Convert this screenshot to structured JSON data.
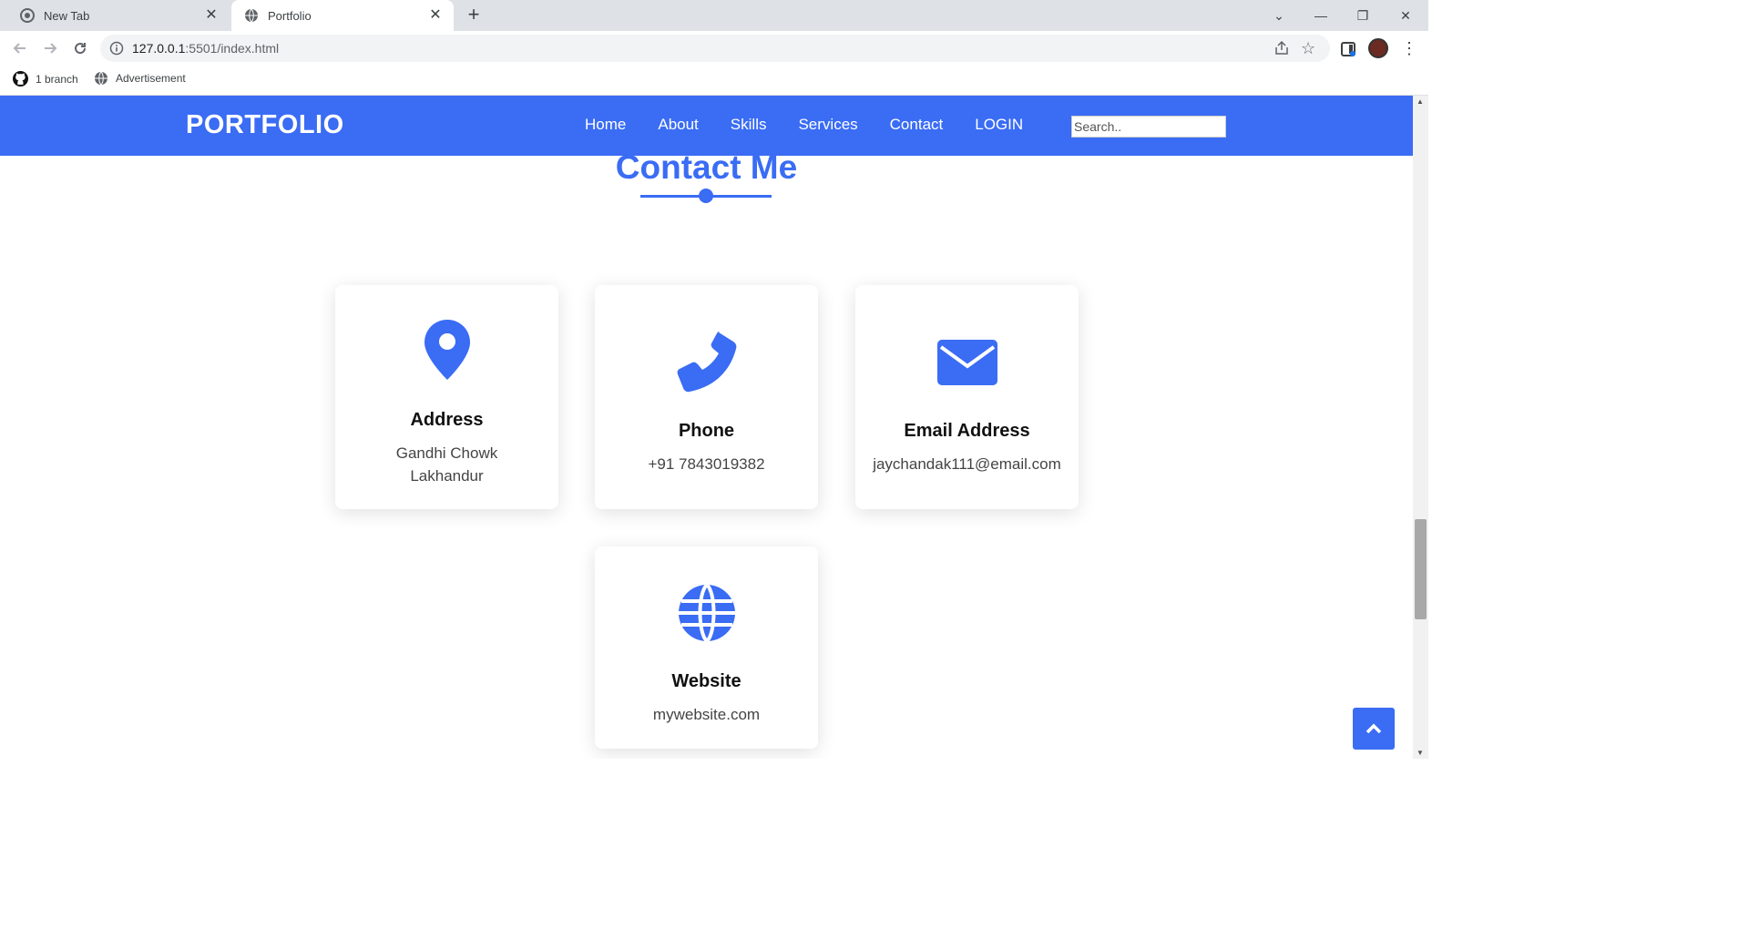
{
  "browser": {
    "tabs": [
      {
        "label": "New Tab"
      },
      {
        "label": "Portfolio"
      }
    ],
    "url_host": "127.0.0.1",
    "url_rest": ":5501/index.html",
    "bookmarks": [
      {
        "label": "1 branch"
      },
      {
        "label": "Advertisement"
      }
    ]
  },
  "header": {
    "logo": "PORTFOLIO",
    "menu": [
      "Home",
      "About",
      "Skills",
      "Services",
      "Contact",
      "LOGIN"
    ],
    "search_placeholder": "Search.."
  },
  "contact": {
    "title": "Contact Me",
    "cards": [
      {
        "icon": "map-pin-icon",
        "title": "Address",
        "text_line1": "Gandhi Chowk",
        "text_line2": "Lakhandur"
      },
      {
        "icon": "phone-icon",
        "title": "Phone",
        "text_line1": "+91 7843019382"
      },
      {
        "icon": "envelope-icon",
        "title": "Email Address",
        "text_line1": "jaychandak111@email.com"
      },
      {
        "icon": "globe-icon",
        "title": "Website",
        "text_line1": "mywebsite.com"
      }
    ]
  },
  "colors": {
    "accent": "#3a6cf4"
  }
}
